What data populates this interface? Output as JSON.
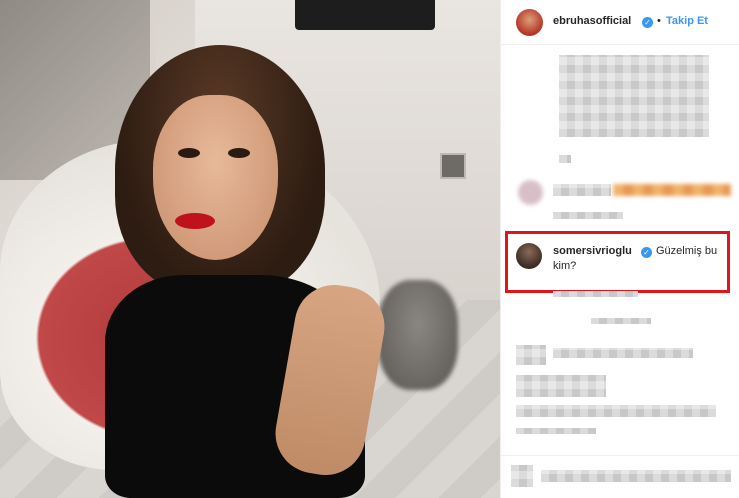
{
  "header": {
    "username": "ebruhasofficial",
    "verified_badge": "✓",
    "separator": "•",
    "follow_label": "Takip Et"
  },
  "comments": {
    "highlighted": {
      "username": "somersivrioglu",
      "verified_badge": "✓",
      "text_line1": "Güzelmiş bu",
      "text_line2": "kim?"
    }
  },
  "colors": {
    "accent": "#3897f0",
    "highlight_border": "#e0141b",
    "lipstick": "#c0121c"
  },
  "icons": [
    "verified-badge-icon"
  ]
}
